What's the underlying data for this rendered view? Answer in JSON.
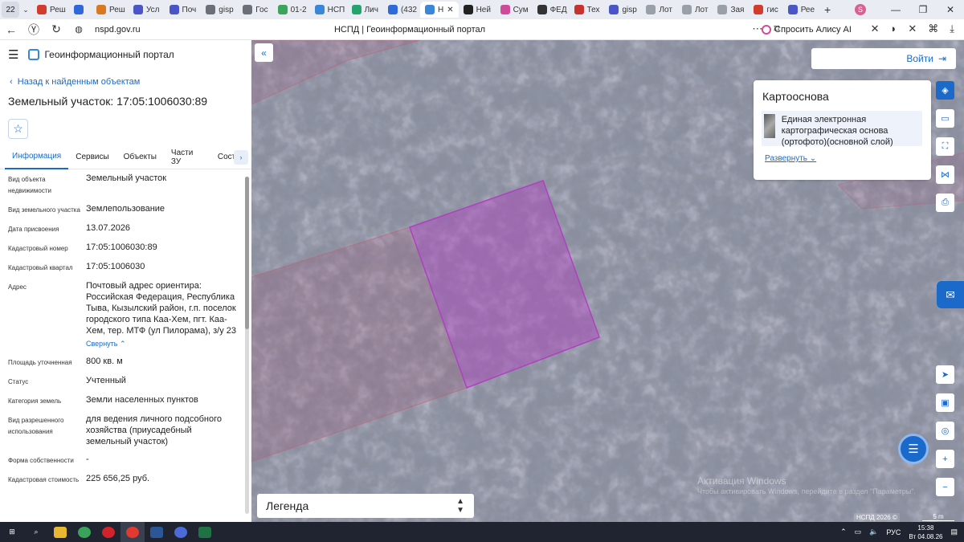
{
  "browser": {
    "tab_count": "22",
    "tabs": [
      {
        "label": "Реш",
        "color": "#d33b2c"
      },
      {
        "label": "",
        "color": "#2f68d8"
      },
      {
        "label": "Реш",
        "color": "#d97a22"
      },
      {
        "label": "Усл",
        "color": "#4a56c5"
      },
      {
        "label": "Поч",
        "color": "#4a56c5"
      },
      {
        "label": "gisp",
        "color": "#6b6f77"
      },
      {
        "label": "Гос",
        "color": "#6b6f77"
      },
      {
        "label": "01-2",
        "color": "#3ba55c"
      },
      {
        "label": "НСП",
        "color": "#3a86d8"
      },
      {
        "label": "Лич",
        "color": "#23a36d"
      },
      {
        "label": "(432",
        "color": "#2f6bd8"
      },
      {
        "label": "Н",
        "color": "#3a86d8"
      },
      {
        "label": "Ней",
        "color": "#222222"
      },
      {
        "label": "Сум",
        "color": "#d04a9a"
      },
      {
        "label": "ФЕД",
        "color": "#333333"
      },
      {
        "label": "Тех",
        "color": "#c7342d"
      },
      {
        "label": "gisp",
        "color": "#4a56c5"
      },
      {
        "label": "Лот",
        "color": "#9aa0a8"
      },
      {
        "label": "Лот",
        "color": "#9aa0a8"
      },
      {
        "label": "Зая",
        "color": "#9aa0a8"
      },
      {
        "label": "гис",
        "color": "#d33b2c"
      },
      {
        "label": "Рее",
        "color": "#4a56c5"
      }
    ],
    "active_tab_index": 11,
    "profile_initial": "S",
    "url": "nspd.gov.ru",
    "page_title": "НСПД | Геоинформационный портал",
    "alisa": "Спросить Алису AI"
  },
  "panel": {
    "portal_title": "Геоинформационный портал",
    "back_link": "Назад к найденным объектам",
    "object_title": "Земельный участок: 17:05:1006030:89",
    "tabs": [
      "Информация",
      "Сервисы",
      "Объекты",
      "Части ЗУ",
      "Состав"
    ],
    "active_tab": 0,
    "collapse_label": "Свернуть",
    "props": [
      {
        "label": "Вид объекта недвижимости",
        "value": "Земельный участок"
      },
      {
        "label": "Вид земельного участка",
        "value": "Землепользование"
      },
      {
        "label": "Дата присвоения",
        "value": "13.07.2026"
      },
      {
        "label": "Кадастровый номер",
        "value": "17:05:1006030:89"
      },
      {
        "label": "Кадастровый квартал",
        "value": "17:05:1006030"
      },
      {
        "label": "Адрес",
        "value": "Почтовый адрес ориентира: Российская Федерация, Республика Тыва, Кызылский район, г.п. поселок городского типа Каа-Хем, пгт. Каа-Хем, тер. МТФ (ул Пилорама), з/у 23"
      },
      {
        "label": "Площадь уточненная",
        "value": "800 кв. м"
      },
      {
        "label": "Статус",
        "value": "Учтенный"
      },
      {
        "label": "Категория земель",
        "value": "Земли населенных пунктов"
      },
      {
        "label": "Вид разрешенного использования",
        "value": "для ведения личного подсобного хозяйства (приусадебный земельный участок)"
      },
      {
        "label": "Форма собственности",
        "value": "-"
      },
      {
        "label": "Кадастровая стоимость",
        "value": "225 656,25 руб."
      }
    ]
  },
  "map": {
    "login_label": "Войти",
    "basemap_title": "Картооснова",
    "basemap_item": "Единая электронная картографическая основа (ортофото)(основной слой)",
    "basemap_expand": "Развернуть",
    "legend_label": "Легенда",
    "watermark_1": "Активация Windows",
    "watermark_2": "Чтобы активировать Windows, перейдите в раздел \"Параметры\".",
    "copyright": "НСПД 2026 ©",
    "scale": "5 m",
    "parcel_color": "#b040c0"
  },
  "taskbar": {
    "time": "15:38",
    "date": "Вт 04.08.26",
    "lang": "РУС"
  }
}
